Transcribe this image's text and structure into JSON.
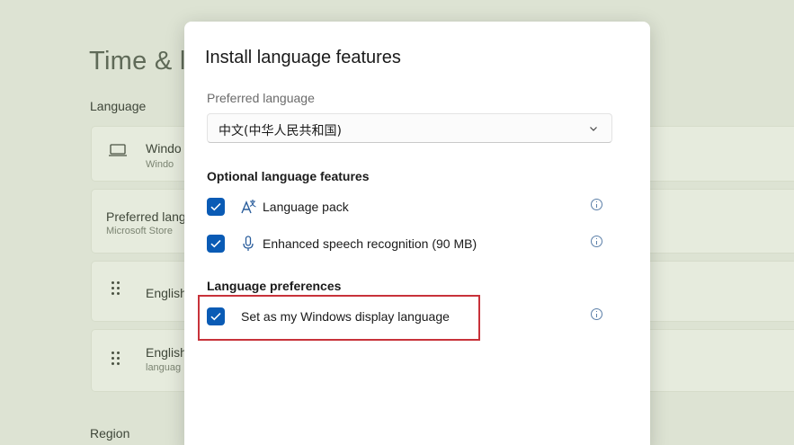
{
  "background": {
    "title": "Time & l",
    "language_section": "Language",
    "region_section": "Region",
    "cards": [
      {
        "title": "Windo",
        "subtitle": "Windo",
        "icon": "laptop-icon"
      },
      {
        "title": "Preferred lang",
        "subtitle": "Microsoft Store"
      },
      {
        "title": "English",
        "subtitle": "",
        "icon": "drag-handle-icon"
      },
      {
        "title": "English",
        "subtitle": "languag",
        "icon": "drag-handle-icon"
      }
    ]
  },
  "dialog": {
    "title": "Install language features",
    "preferred_language_label": "Preferred language",
    "preferred_language_value": "中文(中华人民共和国)",
    "optional_features_heading": "Optional language features",
    "optional_features": [
      {
        "label": "Language pack",
        "checked": true,
        "icon": "language-pack-icon"
      },
      {
        "label": "Enhanced speech recognition (90 MB)",
        "checked": true,
        "icon": "microphone-icon"
      }
    ],
    "preferences_heading": "Language preferences",
    "preferences": [
      {
        "label": "Set as my Windows display language",
        "checked": true
      }
    ]
  },
  "colors": {
    "checkbox_accent": "#0a5bb5",
    "highlight_border": "#c8323a"
  }
}
